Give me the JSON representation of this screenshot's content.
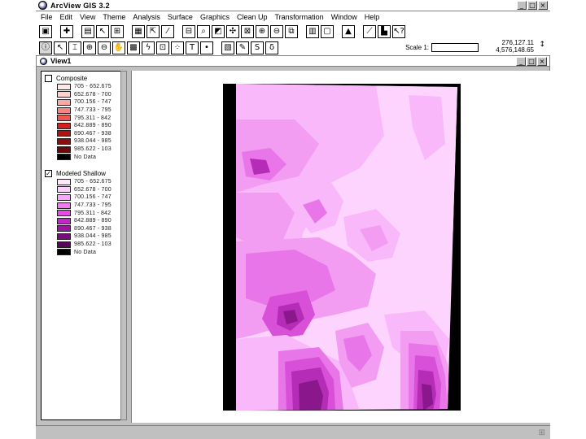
{
  "app": {
    "title": "ArcView GIS 3.2"
  },
  "menus": [
    "File",
    "Edit",
    "View",
    "Theme",
    "Analysis",
    "Surface",
    "Graphics",
    "Clean Up",
    "Transformation",
    "Window",
    "Help"
  ],
  "toolbar1": {
    "icons": [
      "save-icon",
      "add-theme-icon",
      "properties-icon",
      "select-icon",
      "zoom-extent-icon",
      "query-icon",
      "pan-icon",
      "edit-legend-icon",
      "open-table-icon",
      "find-icon",
      "locate-icon",
      "query-builder-icon",
      "zoom-selected-icon",
      "zoom-in-icon",
      "zoom-out-icon",
      "zoom-previous-icon",
      "select-features-icon",
      "clear-selection-icon",
      "histogram-icon",
      "help-arrow-icon",
      "layout-icon",
      "help-icon"
    ]
  },
  "toolbar2": {
    "icons": [
      "identify-icon",
      "pointer-icon",
      "vertex-edit-icon",
      "zoom-in-tool-icon",
      "zoom-out-tool-icon",
      "pan-tool-icon",
      "measure-icon",
      "hotlink-icon",
      "area-select-icon",
      "label-icon",
      "text-icon",
      "draw-point-icon",
      "contour-icon",
      "profile-icon",
      "slope-icon",
      "spot-icon"
    ],
    "scale_label": "Scale 1:",
    "scale_value": "",
    "coord_x": "276,127.11",
    "coord_y": "4,576,148.65"
  },
  "view": {
    "title": "View1",
    "layers": [
      {
        "name": "Composite",
        "checked": false,
        "classes": [
          {
            "label": "705 - 652.675",
            "color": "#ffe8e8"
          },
          {
            "label": "652.678 - 700",
            "color": "#ffd0cf"
          },
          {
            "label": "700.156 - 747",
            "color": "#f9aaa8"
          },
          {
            "label": "747.733 - 795",
            "color": "#f38583"
          },
          {
            "label": "795.311 - 842",
            "color": "#ee5651"
          },
          {
            "label": "842.889 - 890",
            "color": "#d4201a"
          },
          {
            "label": "890.467 - 938",
            "color": "#b01210"
          },
          {
            "label": "938.044 - 985",
            "color": "#8c0e0c"
          },
          {
            "label": "985.622 - 103",
            "color": "#6b0807"
          },
          {
            "label": "No Data",
            "color": "#000000"
          }
        ]
      },
      {
        "name": "Modeled Shallow",
        "checked": true,
        "classes": [
          {
            "label": "705 - 652.675",
            "color": "#fde8fd"
          },
          {
            "label": "652.678 - 700",
            "color": "#fcd0fc"
          },
          {
            "label": "700.156 - 747",
            "color": "#f7a8f7"
          },
          {
            "label": "747.733 - 795",
            "color": "#f07df0"
          },
          {
            "label": "795.311 - 842",
            "color": "#e34de4"
          },
          {
            "label": "842.889 - 890",
            "color": "#c226c6"
          },
          {
            "label": "890.467 - 938",
            "color": "#9c159f"
          },
          {
            "label": "938.044 - 985",
            "color": "#780c7b"
          },
          {
            "label": "985.622 - 103",
            "color": "#560758"
          },
          {
            "label": "No Data",
            "color": "#000000"
          }
        ]
      }
    ]
  },
  "map_colors": {
    "nodata": "#000000",
    "c1": "#fdd4fd",
    "c2": "#f9b8f9",
    "c3": "#f29cf2",
    "c4": "#e976e8",
    "c5": "#d84fd8",
    "c6": "#b52cb6",
    "c7": "#8a178c"
  }
}
